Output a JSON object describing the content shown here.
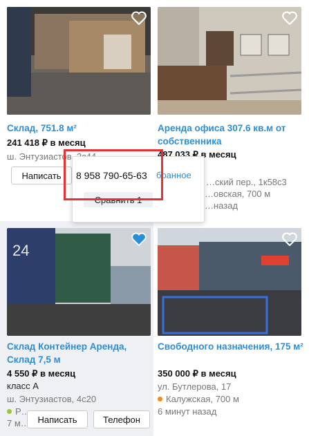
{
  "colors": {
    "link": "#2b8ed9",
    "highlight": "#e53236",
    "metro_orange": "#f08a24",
    "metro_green": "#9ac53a",
    "card_hover": "#eef0f3"
  },
  "cards": [
    {
      "title": "Склад, 751.8 м²",
      "price": "241 418 ₽ в месяц",
      "address": "ш. Энтузиастов, 2с44",
      "favorite_icon": "heart-outline-icon"
    },
    {
      "title": "Аренда офиса 307.6 кв.м от собственника",
      "price": "487 033 ₽ в месяц",
      "address": "…ский пер., 1к58с3",
      "metro": "…овская, 700 м",
      "time": "…назад",
      "favorite_icon": "heart-outline-icon"
    },
    {
      "title": "Склад Контейнер Аренда, Склад 7,5 м",
      "price": "4 550 ₽ в месяц",
      "class": "класс А",
      "address": "ш. Энтузиастов, 4с20",
      "metro": "Р…",
      "time": "7 м…",
      "favorite_icon": "heart-filled-icon"
    },
    {
      "title": "Свободного назначения, 175 м²",
      "price": "350 000 ₽ в месяц",
      "address": "ул. Бутлерова, 17",
      "metro": "Калужская, 700 м",
      "time": "6 минут назад",
      "favorite_icon": "heart-outline-icon"
    }
  ],
  "buttons": {
    "write": "Написать",
    "phone": "Телефон"
  },
  "popup": {
    "phone_number": "8 958 790-65-63",
    "compare": "Сравнить 1",
    "favorites_link": "бранное"
  }
}
